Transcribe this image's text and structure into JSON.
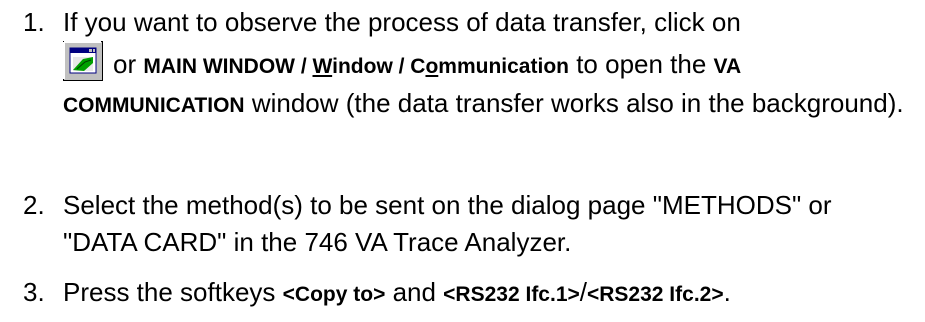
{
  "steps": [
    {
      "number": "1.",
      "line1": "If you want to observe the process of data transfer, click on",
      "icon": "communication-window-icon",
      "or": "or",
      "menu_path": {
        "main_window": "MAIN WINDOW / ",
        "window_key": "W",
        "window_rest": "indow / ",
        "comm_pre": "C",
        "comm_key": "o",
        "comm_rest": "mmunication"
      },
      "to_open": " to open the ",
      "va": "VA",
      "communication": "COMMUNICATION",
      "rest": " window (the data transfer works also in the background)."
    },
    {
      "number": "2.",
      "text": "Select the method(s) to be sent on the dialog page \"METHODS\" or \"DATA CARD\" in the 746 VA Trace Analyzer."
    },
    {
      "number": "3.",
      "press": "Press the softkeys ",
      "copy_to": "<Copy to>",
      "and": " and ",
      "ifc1": "<RS232 Ifc.1>",
      "slash": "/",
      "ifc2": "<RS232 Ifc.2>",
      "period": "."
    }
  ]
}
